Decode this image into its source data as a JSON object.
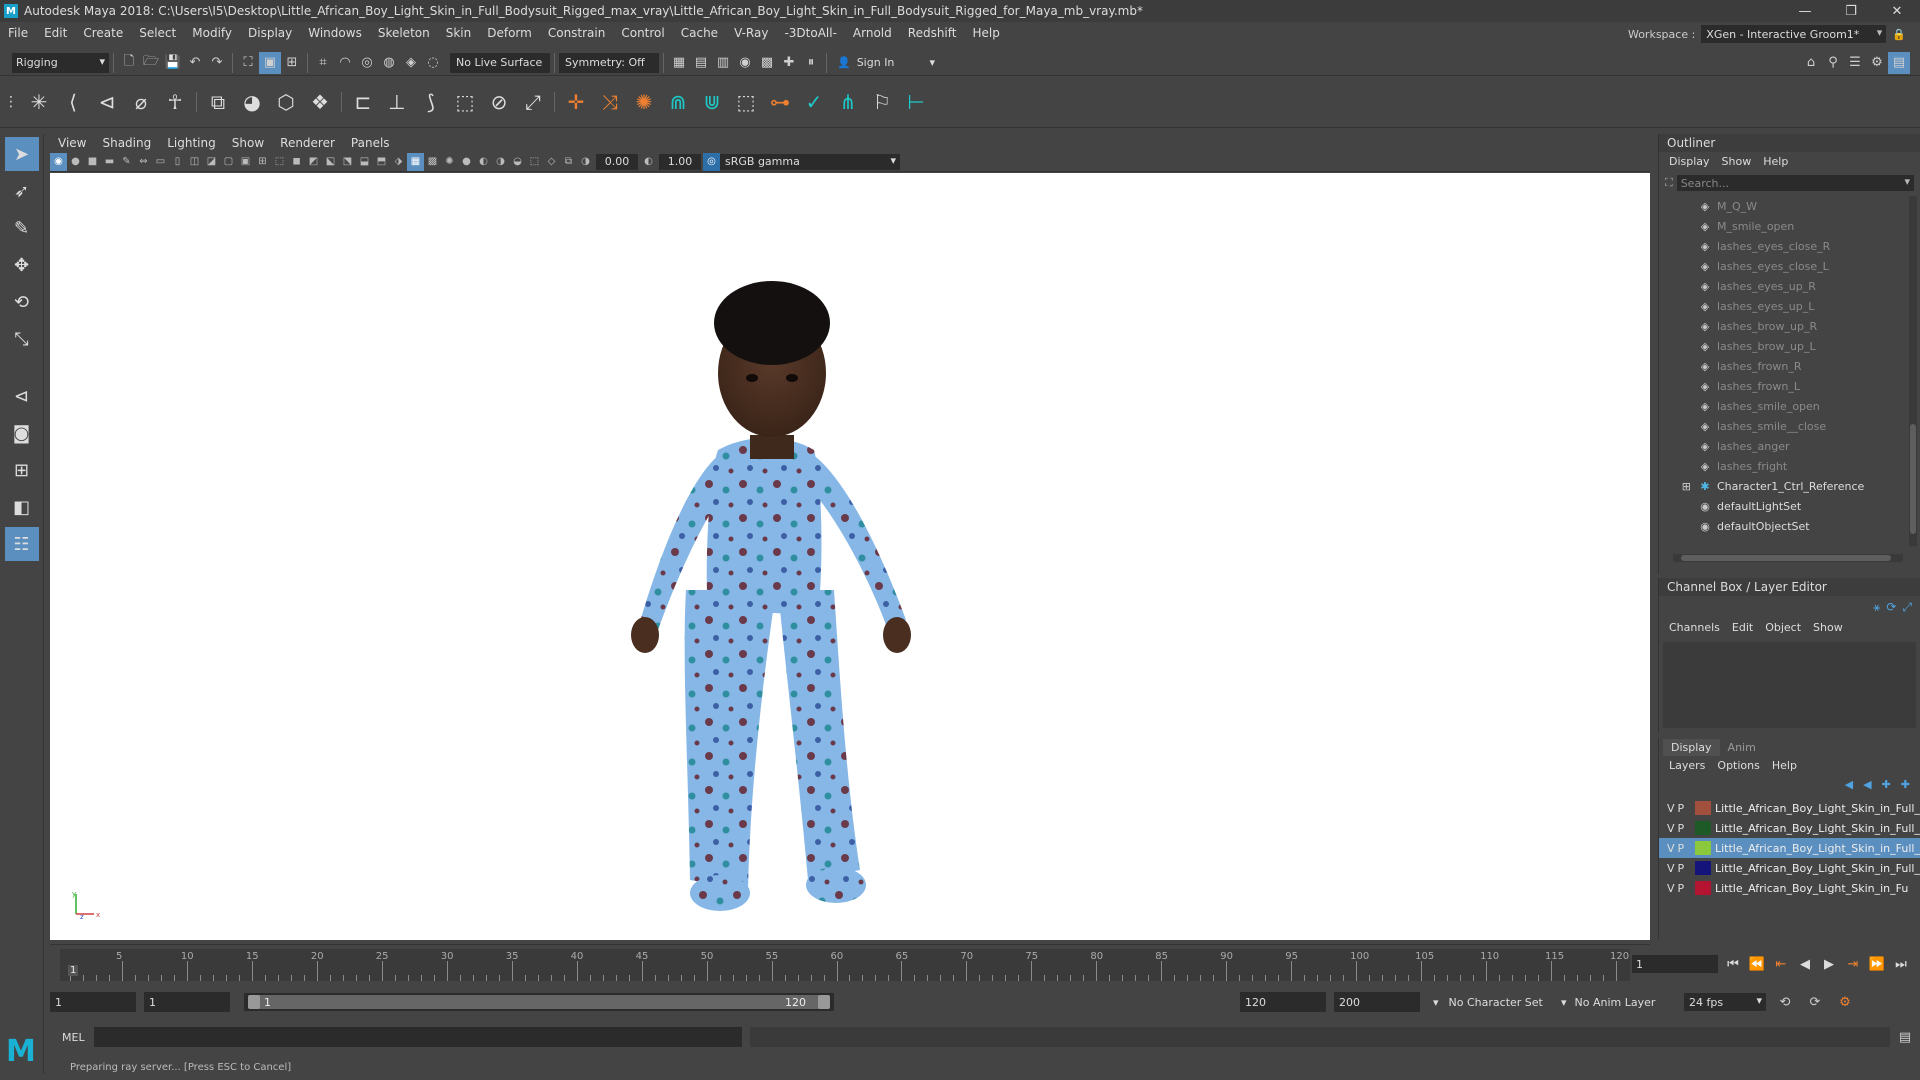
{
  "app": {
    "title": "Autodesk Maya 2018: C:\\Users\\I5\\Desktop\\Little_African_Boy_Light_Skin_in_Full_Bodysuit_Rigged_max_vray\\Little_African_Boy_Light_Skin_in_Full_Bodysuit_Rigged_for_Maya_mb_vray.mb*",
    "logo_letter": "M"
  },
  "menu": [
    "File",
    "Edit",
    "Create",
    "Select",
    "Modify",
    "Display",
    "Windows",
    "Skeleton",
    "Skin",
    "Deform",
    "Constrain",
    "Control",
    "Cache",
    "V-Ray",
    "-3DtoAll-",
    "Arnold",
    "Redshift",
    "Help"
  ],
  "workspace": {
    "label": "Workspace :",
    "value": "XGen - Interactive Groom1*"
  },
  "statusline": {
    "mode": "Rigging",
    "live_surface": "No Live Surface",
    "symmetry": "Symmetry: Off",
    "sign_in": "Sign In"
  },
  "viewport_menu": [
    "View",
    "Shading",
    "Lighting",
    "Show",
    "Renderer",
    "Panels"
  ],
  "viewport_tools": {
    "exposure": "0.00",
    "gamma_value": "1.00",
    "color_space": "sRGB gamma"
  },
  "outliner": {
    "title": "Outliner",
    "menu": [
      "Display",
      "Show",
      "Help"
    ],
    "search_placeholder": "Search...",
    "items": [
      {
        "label": "M_Q_W",
        "dim": true,
        "icon": "blendshape"
      },
      {
        "label": "M_smile_open",
        "dim": true,
        "icon": "blendshape"
      },
      {
        "label": "lashes_eyes_close_R",
        "dim": true,
        "icon": "blendshape"
      },
      {
        "label": "lashes_eyes_close_L",
        "dim": true,
        "icon": "blendshape"
      },
      {
        "label": "lashes_eyes_up_R",
        "dim": true,
        "icon": "blendshape"
      },
      {
        "label": "lashes_eyes_up_L",
        "dim": true,
        "icon": "blendshape"
      },
      {
        "label": "lashes_brow_up_R",
        "dim": true,
        "icon": "blendshape"
      },
      {
        "label": "lashes_brow_up_L",
        "dim": true,
        "icon": "blendshape"
      },
      {
        "label": "lashes_frown_R",
        "dim": true,
        "icon": "blendshape"
      },
      {
        "label": "lashes_frown_L",
        "dim": true,
        "icon": "blendshape"
      },
      {
        "label": "lashes_smile_open",
        "dim": true,
        "icon": "blendshape"
      },
      {
        "label": "lashes_smile__close",
        "dim": true,
        "icon": "blendshape"
      },
      {
        "label": "lashes_anger",
        "dim": true,
        "icon": "blendshape"
      },
      {
        "label": "lashes_fright",
        "dim": true,
        "icon": "blendshape"
      },
      {
        "label": "Character1_Ctrl_Reference",
        "dim": false,
        "icon": "joint",
        "expand": "⊞"
      },
      {
        "label": "defaultLightSet",
        "dim": false,
        "icon": "set"
      },
      {
        "label": "defaultObjectSet",
        "dim": false,
        "icon": "set"
      }
    ]
  },
  "channel_box": {
    "title": "Channel Box / Layer Editor",
    "menu": [
      "Channels",
      "Edit",
      "Object",
      "Show"
    ]
  },
  "layer_editor": {
    "tabs": [
      "Display",
      "Anim"
    ],
    "menu": [
      "Layers",
      "Options",
      "Help"
    ],
    "layers": [
      {
        "vis": "V",
        "pick": "P",
        "color": "#a0503c",
        "name": "Little_African_Boy_Light_Skin_in_Full_",
        "selected": false
      },
      {
        "vis": "V",
        "pick": "P",
        "color": "#1e5a28",
        "name": "Little_African_Boy_Light_Skin_in_Full_",
        "selected": false
      },
      {
        "vis": "V",
        "pick": "P",
        "color": "#8cc83c",
        "name": "Little_African_Boy_Light_Skin_in_Full_",
        "selected": true
      },
      {
        "vis": "V",
        "pick": "P",
        "color": "#14147a",
        "name": "Little_African_Boy_Light_Skin_in_Full_",
        "selected": false
      },
      {
        "vis": "V",
        "pick": "P",
        "color": "#b41432",
        "name": "Little_African_Boy_Light_Skin_in_Fu",
        "selected": false
      }
    ]
  },
  "timeline": {
    "ticks": [
      5,
      10,
      15,
      20,
      25,
      30,
      35,
      40,
      45,
      50,
      55,
      60,
      65,
      70,
      75,
      80,
      85,
      90,
      95,
      100,
      105,
      110,
      115,
      120
    ],
    "start_marker": "1",
    "min": 1,
    "max": 120,
    "current_frame": "1"
  },
  "range": {
    "start": "1",
    "playback_start": "1",
    "slider_start": "1",
    "slider_end": "120",
    "playback_end": "120",
    "end": "200",
    "character_set": "No Character Set",
    "anim_layer": "No Anim Layer",
    "fps": "24 fps"
  },
  "command": {
    "language": "MEL"
  },
  "help_line": "Preparing ray server... [Press ESC to Cancel]",
  "colors": {
    "accent": "#5b8fbf",
    "panel": "#444444",
    "field": "#2b2b2b",
    "maya_blue": "#1ab2d4"
  }
}
